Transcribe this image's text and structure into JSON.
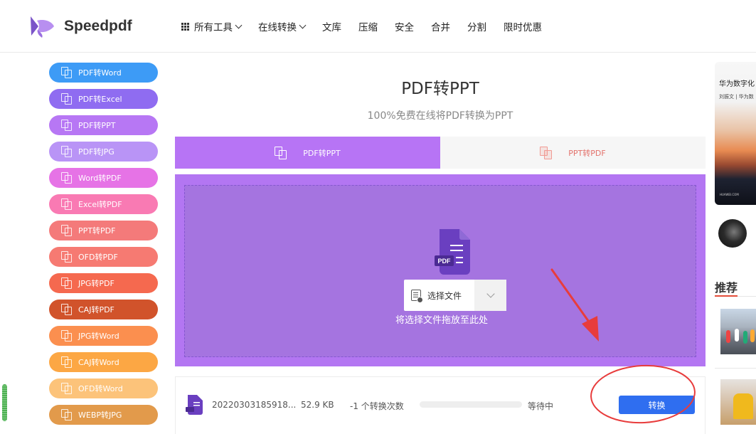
{
  "brand": {
    "name": "Speedpdf"
  },
  "nav": {
    "items": [
      {
        "label": "所有工具",
        "has_dropdown": true,
        "has_grid_icon": true
      },
      {
        "label": "在线转换",
        "has_dropdown": true
      },
      {
        "label": "文库"
      },
      {
        "label": "压缩"
      },
      {
        "label": "安全"
      },
      {
        "label": "合并"
      },
      {
        "label": "分割"
      },
      {
        "label": "限时优惠"
      }
    ]
  },
  "sidebar": {
    "items": [
      {
        "label": "PDF转Word",
        "color": "#3d9bf6"
      },
      {
        "label": "PDF转Excel",
        "color": "#8f6cf1"
      },
      {
        "label": "PDF转PPT",
        "color": "#b777f4"
      },
      {
        "label": "PDF转JPG",
        "color": "#b994f6"
      },
      {
        "label": "Word转PDF",
        "color": "#e673e6"
      },
      {
        "label": "Excel转PDF",
        "color": "#f97ab3"
      },
      {
        "label": "PPT转PDF",
        "color": "#f47a7a"
      },
      {
        "label": "OFD转PDF",
        "color": "#f67a72"
      },
      {
        "label": "JPG转PDF",
        "color": "#f5694f"
      },
      {
        "label": "CAJ转PDF",
        "color": "#d1532b"
      },
      {
        "label": "JPG转Word",
        "color": "#fb8f4f"
      },
      {
        "label": "CAJ转Word",
        "color": "#fca744"
      },
      {
        "label": "OFD转Word",
        "color": "#fcc37a"
      },
      {
        "label": "WEBP转JPG",
        "color": "#e29a4b"
      }
    ]
  },
  "main": {
    "title": "PDF转PPT",
    "subtitle": "100%免费在线将PDF转换为PPT",
    "tabs": [
      {
        "label": "PDF转PPT",
        "active": true
      },
      {
        "label": "PPT转PDF",
        "active": false
      }
    ],
    "upload": {
      "file_icon_label": "PDF",
      "choose_label": "选择文件",
      "drop_hint": "将选择文件拖放至此处"
    },
    "file_row": {
      "name": "20220303185918...",
      "size": "52.9 KB",
      "count": "-1 个转换次数",
      "status": "等待中",
      "progress": 0,
      "convert_label": "转换"
    }
  },
  "right": {
    "ad_title": "华为数字化",
    "ad_sub": "刘振文 | 华为数",
    "ad_foot": "HUAWEI.COM",
    "recommend_title": "推荐"
  },
  "colors": {
    "accent": "#b376f2",
    "tab_active": "#b774f5",
    "convert_button": "#2f6ef0",
    "annotation_red": "#e83c3c"
  }
}
